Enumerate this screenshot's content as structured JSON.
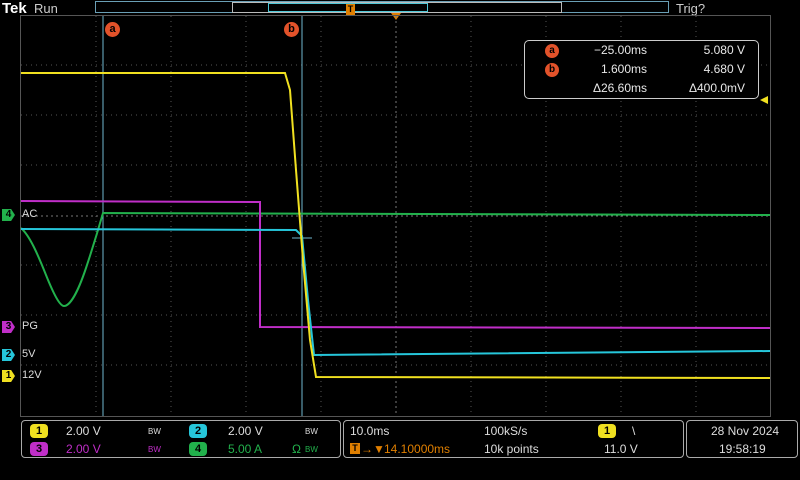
{
  "status": {
    "brand": "Tek",
    "run_state": "Run",
    "trigger_state": "Trig?"
  },
  "cursors": {
    "a": {
      "label": "a"
    },
    "b": {
      "label": "b"
    }
  },
  "measurement": {
    "a_time": "−25.00ms",
    "a_value": "5.080 V",
    "b_time": "1.600ms",
    "b_value": "4.680 V",
    "delta_time": "Δ26.60ms",
    "delta_value": "Δ400.0mV"
  },
  "channels": {
    "ch4": {
      "num": "4",
      "label": "AC",
      "color": "#22b14c"
    },
    "ch3": {
      "num": "3",
      "label": "PG",
      "color": "#c02ec8"
    },
    "ch2": {
      "num": "2",
      "label": "5V",
      "color": "#26c6da"
    },
    "ch1": {
      "num": "1",
      "label": "12V",
      "color": "#f0e020"
    }
  },
  "vertical": {
    "ch1_scale": "2.00 V",
    "ch2_scale": "2.00 V",
    "ch3_scale": "2.00 V",
    "ch4_scale": "5.00 A",
    "bw": "BW",
    "ohm": "Ω"
  },
  "horizontal": {
    "time_div": "10.0ms",
    "sample_rate": "100kS/s",
    "trigger_pos": "14.10000ms",
    "record_len": "10k points"
  },
  "trigger": {
    "source": "1",
    "slope": "\\",
    "level": "11.0 V"
  },
  "datetime": {
    "date": "28 Nov 2024",
    "time": "19:58:19"
  }
}
